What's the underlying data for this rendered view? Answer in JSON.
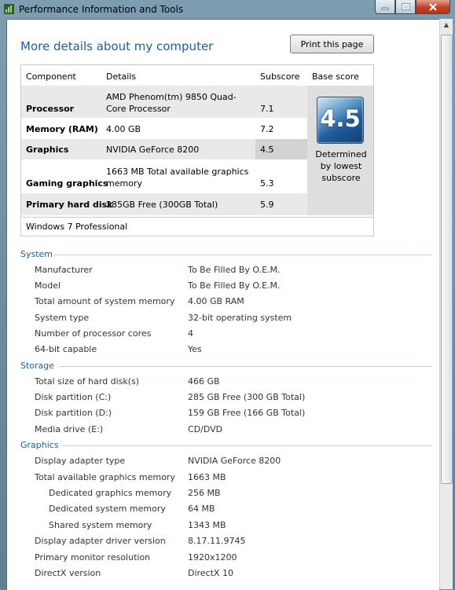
{
  "window": {
    "title": "Performance Information and Tools"
  },
  "header": {
    "title": "More details about my computer",
    "print_button": "Print this page"
  },
  "score_table": {
    "headers": {
      "component": "Component",
      "details": "Details",
      "subscore": "Subscore",
      "base_score": "Base score"
    },
    "rows": [
      {
        "component": "Processor",
        "details": "AMD Phenom(tm) 9850 Quad-Core Processor",
        "subscore": "7.1"
      },
      {
        "component": "Memory (RAM)",
        "details": "4.00 GB",
        "subscore": "7.2"
      },
      {
        "component": "Graphics",
        "details": "NVIDIA GeForce 8200",
        "subscore": "4.5"
      },
      {
        "component": "Gaming graphics",
        "details": "1663 MB Total available graphics memory",
        "subscore": "5.3"
      },
      {
        "component": "Primary hard disk",
        "details": "285GB Free (300GB Total)",
        "subscore": "5.9"
      }
    ],
    "base_score": "4.5",
    "base_score_note": "Determined by lowest subscore",
    "os": "Windows 7 Professional"
  },
  "sections": {
    "system": {
      "title": "System",
      "rows": [
        {
          "label": "Manufacturer",
          "value": "To Be Filled By O.E.M."
        },
        {
          "label": "Model",
          "value": "To Be Filled By O.E.M."
        },
        {
          "label": "Total amount of system memory",
          "value": "4.00 GB RAM"
        },
        {
          "label": "System type",
          "value": "32-bit operating system"
        },
        {
          "label": "Number of processor cores",
          "value": "4"
        },
        {
          "label": "64-bit capable",
          "value": "Yes"
        }
      ]
    },
    "storage": {
      "title": "Storage",
      "rows": [
        {
          "label": "Total size of hard disk(s)",
          "value": "466 GB"
        },
        {
          "label": "Disk partition (C:)",
          "value": "285 GB Free (300 GB Total)"
        },
        {
          "label": "Disk partition (D:)",
          "value": "159 GB Free (166 GB Total)"
        },
        {
          "label": "Media drive (E:)",
          "value": "CD/DVD"
        }
      ]
    },
    "graphics": {
      "title": "Graphics",
      "rows": [
        {
          "label": "Display adapter type",
          "value": "NVIDIA GeForce 8200"
        },
        {
          "label": "Total available graphics memory",
          "value": "1663 MB"
        },
        {
          "label": "Dedicated graphics memory",
          "value": "256 MB"
        },
        {
          "label": "Dedicated system memory",
          "value": "64 MB"
        },
        {
          "label": "Shared system memory",
          "value": "1343 MB"
        },
        {
          "label": "Display adapter driver version",
          "value": "8.17.11.9745"
        },
        {
          "label": "Primary monitor resolution",
          "value": "1920x1200"
        },
        {
          "label": "DirectX version",
          "value": "DirectX 10"
        }
      ]
    }
  }
}
